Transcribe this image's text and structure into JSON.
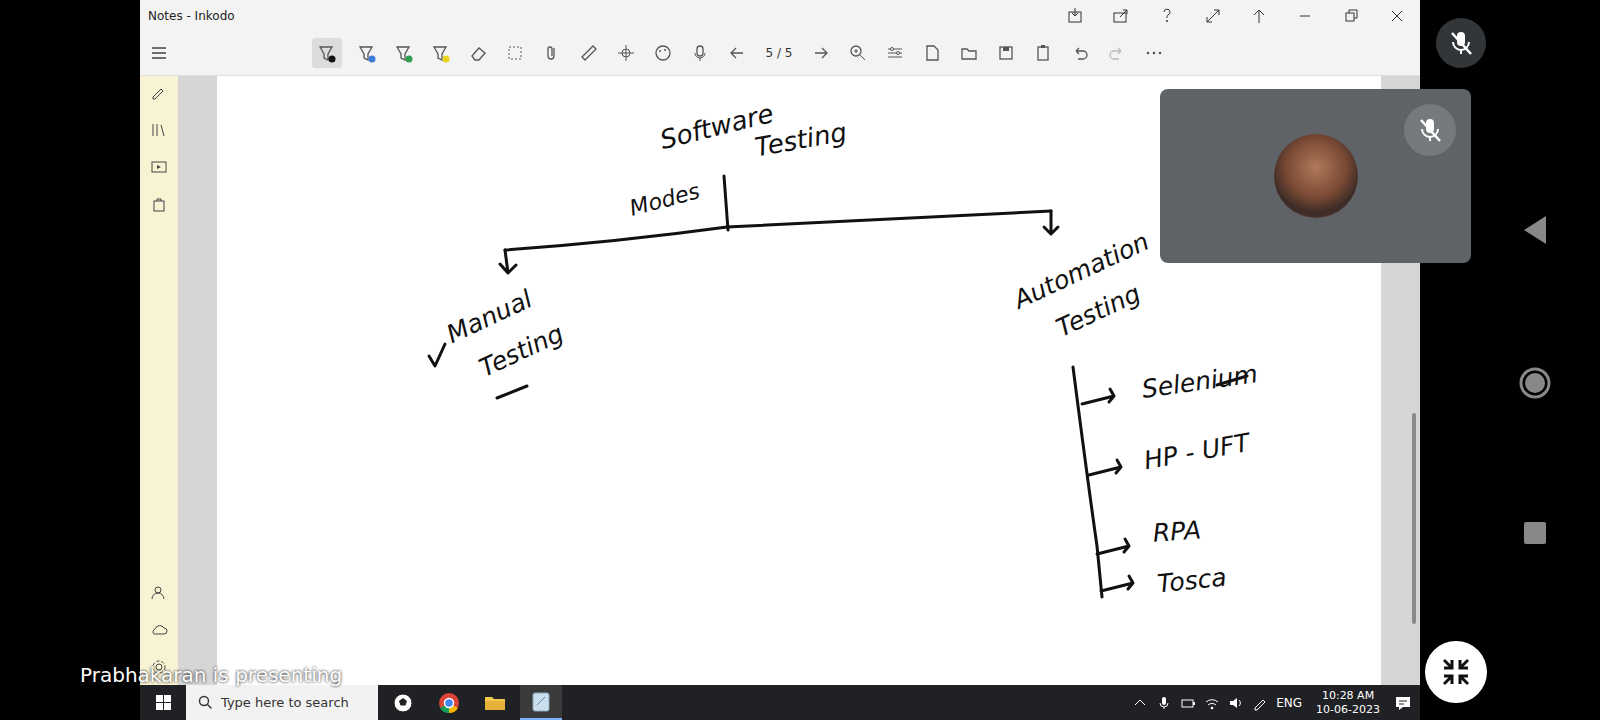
{
  "window": {
    "title": "Notes - Inkodo"
  },
  "toolbar": {
    "page": "5 / 5"
  },
  "diagram": {
    "root": {
      "lines": [
        "Software",
        "Testing"
      ]
    },
    "edge_label": "Modes",
    "manual": {
      "lines": [
        "Manual",
        "Testing"
      ],
      "checked": true
    },
    "automation": {
      "lines": [
        "Automation",
        "Testing"
      ]
    },
    "tools": [
      "Selenium",
      "HP - UFT",
      "RPA",
      "Tosca"
    ]
  },
  "taskbar": {
    "search_placeholder": "Type here to search",
    "language": "ENG",
    "time": "10:28 AM",
    "date": "10-06-2023"
  },
  "meeting": {
    "presenter_banner": "Prabhakaran is presenting",
    "self_muted": true,
    "participant_muted": true
  }
}
